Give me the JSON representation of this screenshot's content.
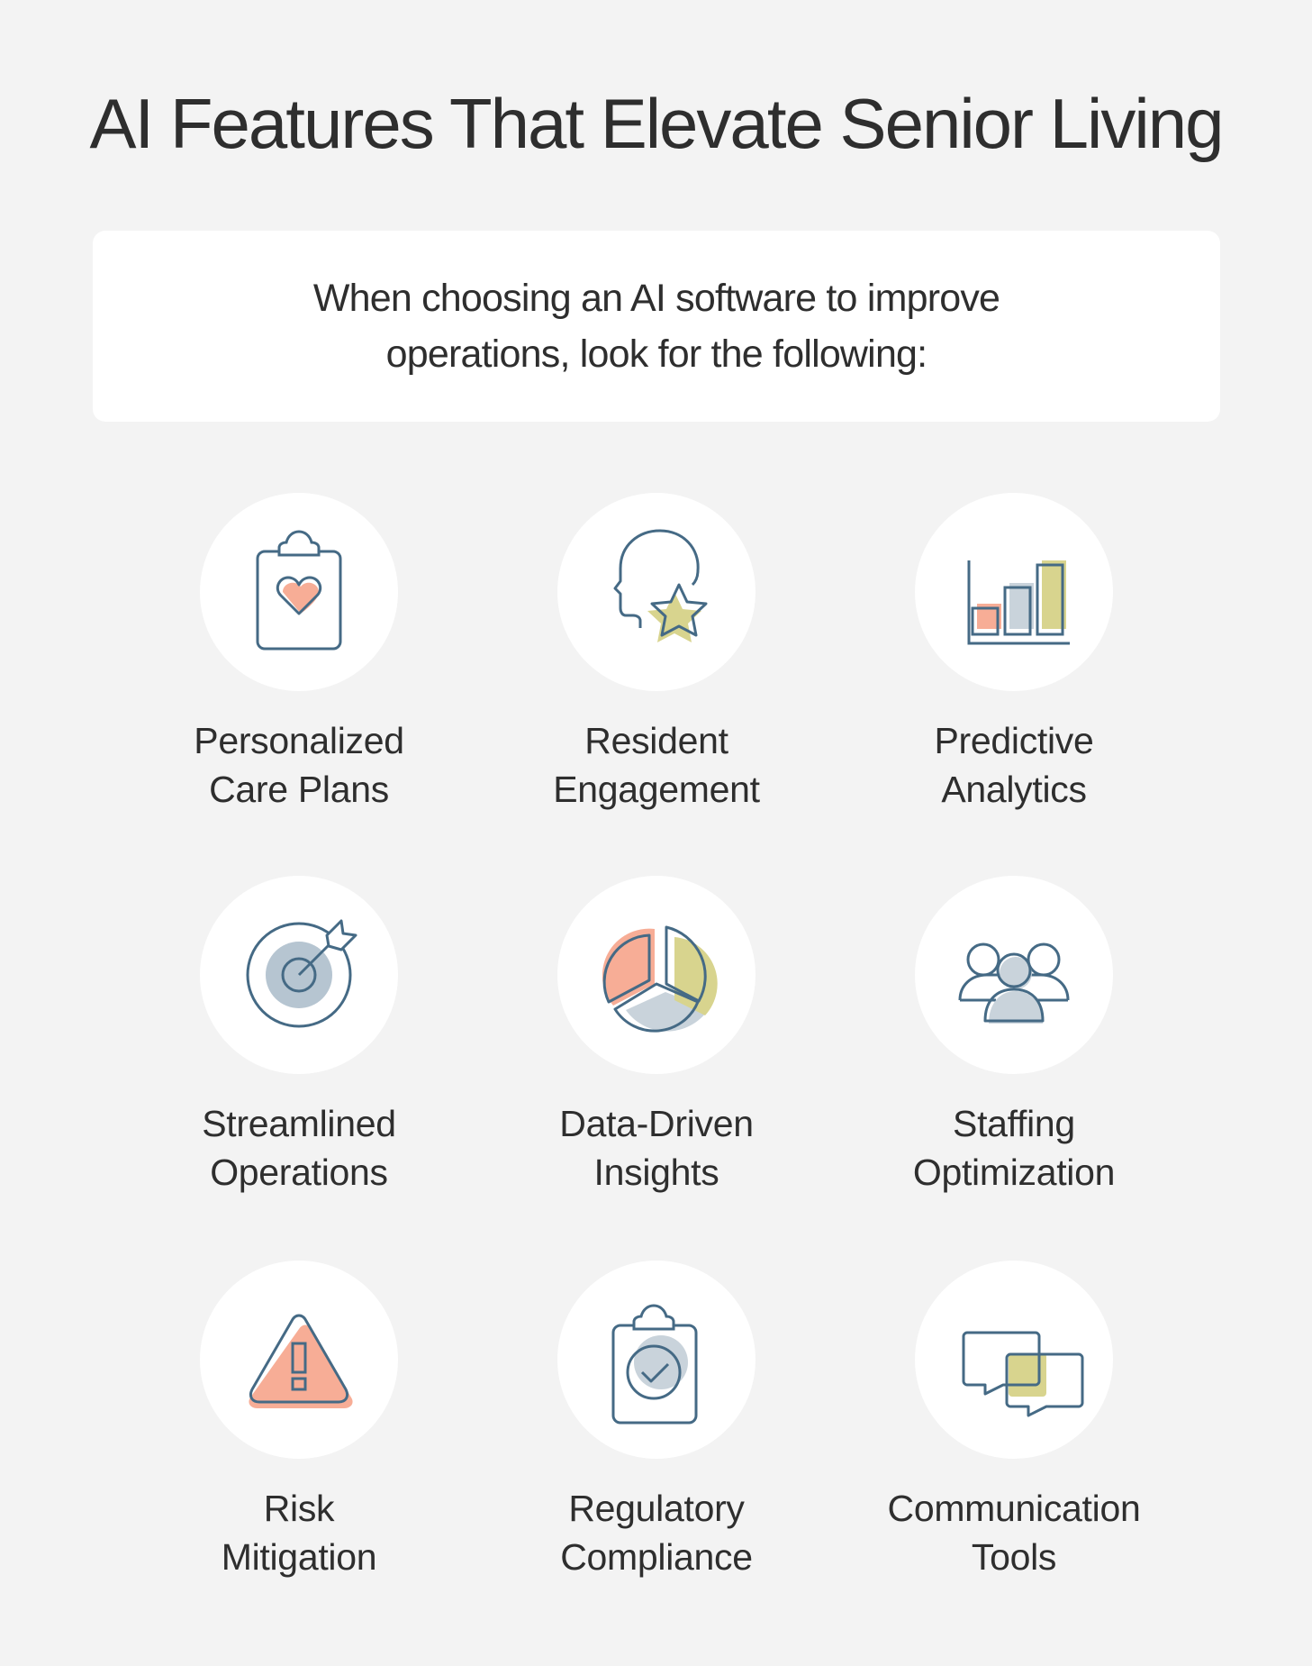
{
  "header": {
    "title": "AI Features That Elevate Senior Living"
  },
  "intro": {
    "line1": "When choosing an AI software to improve",
    "line2": "operations, look for the following:"
  },
  "colors": {
    "background": "#f3f3f3",
    "card": "#ffffff",
    "text": "#2e2e2e",
    "icon_stroke": "#456a85",
    "accent_salmon": "#f7ad96",
    "accent_olive": "#d8d48e",
    "accent_slate": "#c9d3db"
  },
  "features": [
    {
      "icon": "clipboard-heart-icon",
      "line1": "Personalized",
      "line2": "Care Plans"
    },
    {
      "icon": "head-star-icon",
      "line1": "Resident",
      "line2": "Engagement"
    },
    {
      "icon": "bar-chart-icon",
      "line1": "Predictive",
      "line2": "Analytics"
    },
    {
      "icon": "target-arrow-icon",
      "line1": "Streamlined",
      "line2": "Operations"
    },
    {
      "icon": "pie-chart-icon",
      "line1": "Data-Driven",
      "line2": "Insights"
    },
    {
      "icon": "team-icon",
      "line1": "Staffing",
      "line2": "Optimization"
    },
    {
      "icon": "warning-triangle-icon",
      "line1": "Risk",
      "line2": "Mitigation"
    },
    {
      "icon": "clipboard-check-icon",
      "line1": "Regulatory",
      "line2": "Compliance"
    },
    {
      "icon": "chat-bubbles-icon",
      "line1": "Communication",
      "line2": "Tools"
    }
  ]
}
